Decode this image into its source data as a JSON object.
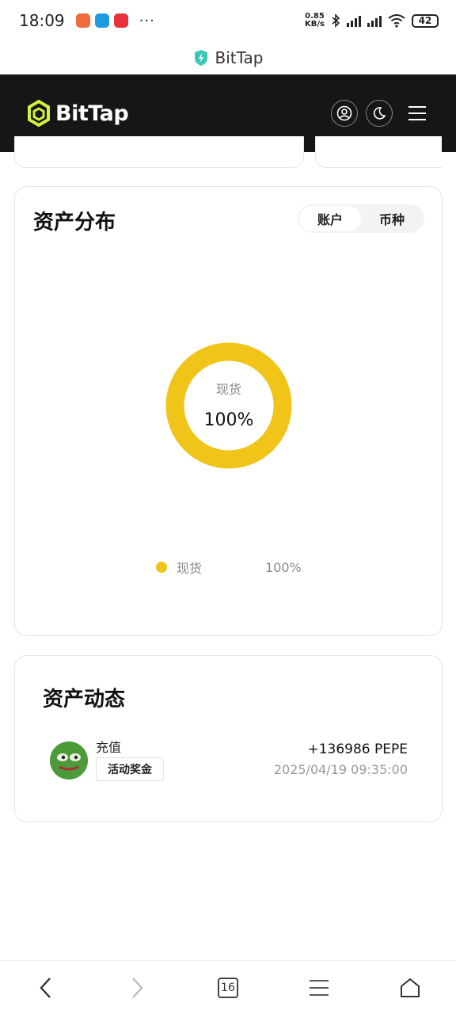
{
  "status_bar": {
    "time": "18:09",
    "more": "···",
    "net_speed_value": "0.85",
    "net_speed_unit": "KB/s",
    "battery": "42"
  },
  "browser": {
    "title": "BitTap"
  },
  "header": {
    "logo_text": "BitTap",
    "brand_color": "#d7f03a"
  },
  "distribution": {
    "title": "资产分布",
    "tabs": [
      {
        "label": "账户",
        "active": true
      },
      {
        "label": "币种",
        "active": false
      }
    ],
    "center_label": "现货",
    "center_value": "100%",
    "legend": [
      {
        "name": "现货",
        "value": "100%",
        "color": "#f0c419"
      }
    ]
  },
  "chart_data": {
    "type": "pie",
    "categories": [
      "现货"
    ],
    "values": [
      100
    ],
    "colors": [
      "#f0c419"
    ]
  },
  "activity": {
    "title": "资产动态",
    "items": [
      {
        "type": "充值",
        "tag": "活动奖金",
        "amount": "+136986 PEPE",
        "time": "2025/04/19 09:35:00"
      }
    ]
  },
  "bottom_nav": {
    "tab_count": "16"
  }
}
